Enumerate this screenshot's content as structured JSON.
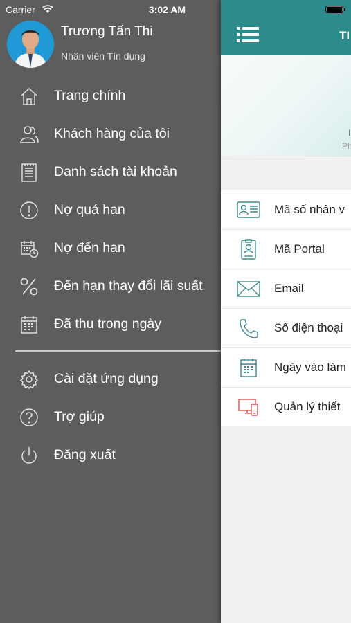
{
  "status_bar": {
    "carrier": "Carrier",
    "time": "3:02 AM"
  },
  "profile": {
    "name": "Trương Tấn Thi",
    "role": "Nhân viên Tín dụng"
  },
  "menu": [
    {
      "label": "Trang chính",
      "icon": "home-icon"
    },
    {
      "label": "Khách hàng của tôi",
      "icon": "customers-icon"
    },
    {
      "label": "Danh sách tài khoản",
      "icon": "account-list-icon"
    },
    {
      "label": "Nợ quá hạn",
      "icon": "overdue-icon"
    },
    {
      "label": "Nợ đến hạn",
      "icon": "due-calendar-icon"
    },
    {
      "label": "Đến hạn thay đổi lãi suất",
      "icon": "percent-icon"
    },
    {
      "label": "Đã thu trong ngày",
      "icon": "calendar-icon"
    }
  ],
  "menu_secondary": [
    {
      "label": "Cài đặt ứng dụng",
      "icon": "gear-icon"
    },
    {
      "label": "Trợ giúp",
      "icon": "help-icon"
    },
    {
      "label": "Đăng xuất",
      "icon": "power-icon"
    }
  ],
  "main": {
    "nav_title": "TI",
    "banner_line1": "I",
    "banner_line2": "Ph",
    "info_rows": [
      {
        "label": "Mã số nhân v",
        "icon": "id-card-icon"
      },
      {
        "label": "Mã Portal",
        "icon": "badge-icon"
      },
      {
        "label": "Email",
        "icon": "email-icon"
      },
      {
        "label": "Số điện thoại",
        "icon": "phone-icon"
      },
      {
        "label": "Ngày vào làm",
        "icon": "calendar-icon"
      },
      {
        "label": "Quản lý thiết",
        "icon": "devices-icon"
      }
    ]
  },
  "colors": {
    "drawer_bg": "#5d5d5d",
    "navbar": "#2b8c8b",
    "icon_teal": "#3c8c8c",
    "icon_red": "#d9534f"
  }
}
